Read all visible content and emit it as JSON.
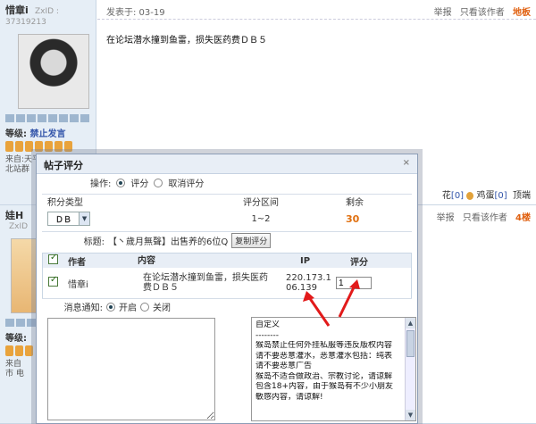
{
  "post1": {
    "username": "惜章i",
    "uid": "ZxID : 37319213",
    "posted": "发表于: 03-19",
    "report": "举报",
    "only_author": "只看该作者",
    "floor": "地板",
    "content": "在论坛潜水撞到鱼雷，损失医药费ＤＢ５",
    "level_label": "等级:",
    "level_value": "禁止发言",
    "from_text": "来自:天平洋服\n北站群",
    "footer_ops": {
      "pre": "花",
      "count1": "[0]",
      "egg": "鸡蛋",
      "count2": "[0]",
      "top": "顶端"
    }
  },
  "post2": {
    "username": "娃H",
    "uid": "ZxID",
    "report": "举报",
    "only_author": "只看该作者",
    "floor": "4楼",
    "level_label": "等级:",
    "from_text": "来自\n市 电"
  },
  "dialog": {
    "title": "帖子评分",
    "close": "×",
    "op_label": "操作:",
    "op_rate": "评分",
    "op_cancel": "取消评分",
    "col_type": "积分类型",
    "col_range": "评分区间",
    "col_left": "剩余",
    "type_value": "ＤＢ",
    "range_value": "1~2",
    "left_value": "30",
    "title_label": "标题:",
    "title_value": "【丶歲月無聲】出售养的6位Q",
    "copy_btn": "复制评分",
    "th_author": "作者",
    "th_content": "内容",
    "th_ip": "IP",
    "th_score": "评分",
    "row_author": "惜章i",
    "row_content": "在论坛潜水撞到鱼雷，损失医药费ＤＢ５",
    "row_ip": "220.173.106.139",
    "row_score": "1",
    "notify_label": "消息通知:",
    "notify_on": "开启",
    "notify_off": "关闭",
    "reasons": [
      "自定义",
      "--------",
      "猴岛禁止任何外挂私服等违反版权内容",
      "请不要恶意灌水，恶意灌水包括：纯表",
      "请不要恶意广告",
      "猴岛不适合做政治、宗教讨论，请谅解",
      "包含18+内容，由于猴岛有不少小朋友",
      "敏感内容，请谅解!"
    ]
  }
}
